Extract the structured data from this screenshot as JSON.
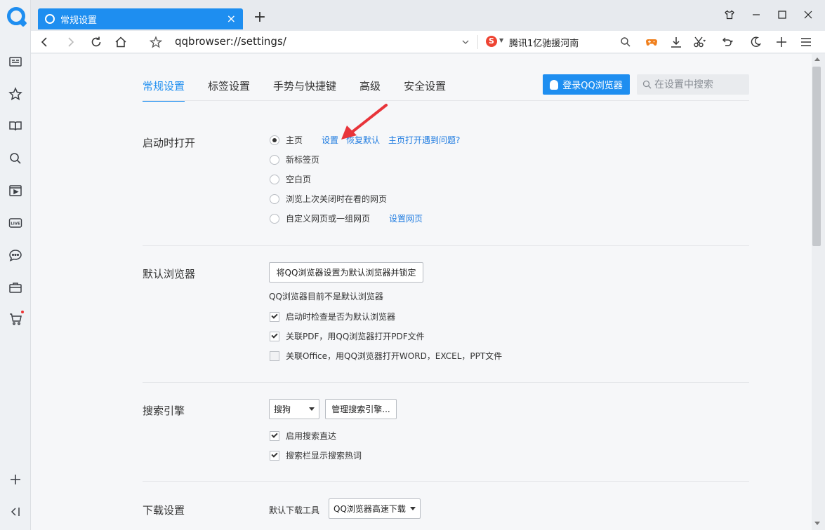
{
  "tab": {
    "title": "常规设置",
    "close": "×",
    "new": "+"
  },
  "toolbar": {
    "url": "qqbrowser://settings/",
    "search_engine_badge": "S",
    "hot_query": "腾讯1亿驰援河南"
  },
  "nav": {
    "items": [
      "常规设置",
      "标签设置",
      "手势与快捷键",
      "高级",
      "安全设置"
    ],
    "active_index": 0,
    "login_label": "登录QQ浏览器",
    "search_placeholder": "在设置中搜索"
  },
  "startup": {
    "title": "启动时打开",
    "options": [
      "主页",
      "新标签页",
      "空白页",
      "浏览上次关闭时在看的网页",
      "自定义网页或一组网页"
    ],
    "selected_index": 0,
    "home_links": [
      "设置",
      "恢复默认",
      "主页打开遇到问题?"
    ],
    "custom_link": "设置网页"
  },
  "default_browser": {
    "title": "默认浏览器",
    "button": "将QQ浏览器设置为默认浏览器并锁定",
    "status": "QQ浏览器目前不是默认浏览器",
    "checks": [
      {
        "label": "启动时检查是否为默认浏览器",
        "checked": true
      },
      {
        "label": "关联PDF，用QQ浏览器打开PDF文件",
        "checked": true
      },
      {
        "label": "关联Office，用QQ浏览器打开WORD，EXCEL，PPT文件",
        "checked": false
      }
    ]
  },
  "search_engine": {
    "title": "搜索引擎",
    "selected": "搜狗",
    "manage_button": "管理搜索引擎...",
    "checks": [
      {
        "label": "启用搜索直达",
        "checked": true
      },
      {
        "label": "搜索栏显示搜索热词",
        "checked": true
      }
    ]
  },
  "download": {
    "title": "下载设置",
    "default_tool_label": "默认下载工具",
    "default_tool_value": "QQ浏览器高速下载"
  },
  "colors": {
    "accent": "#1e8ef0",
    "link": "#1e7be0",
    "annotation": "#e8343a"
  }
}
